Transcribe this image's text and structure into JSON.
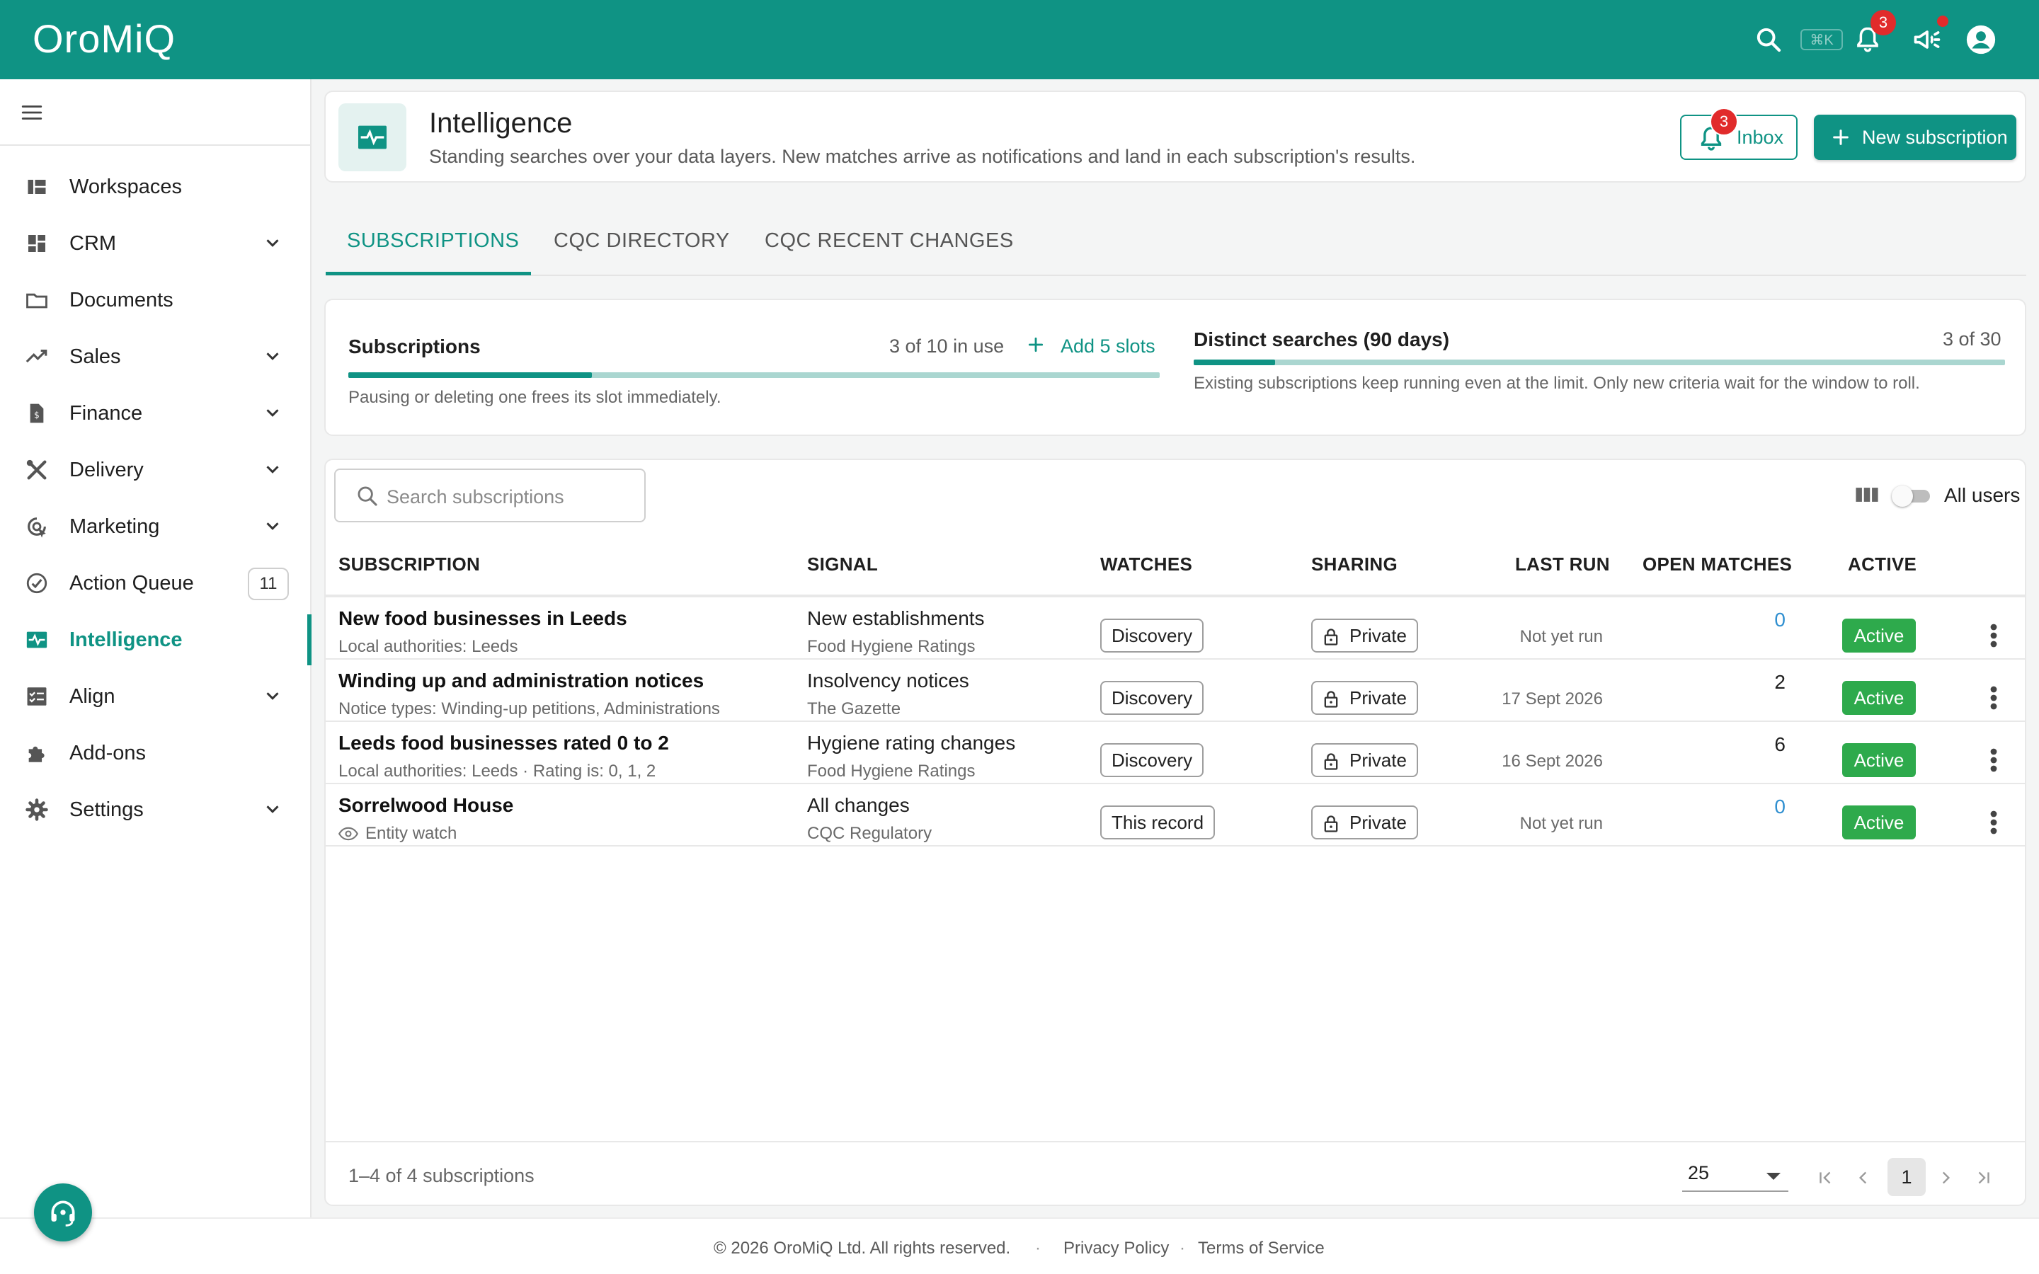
{
  "app": {
    "logo": "OroMiQ",
    "shortcut_hint": "⌘K",
    "notifications_count": "3"
  },
  "colors": {
    "brand": "#0f9384",
    "badge": "#e12b2b",
    "active_status": "#2eaa4c"
  },
  "sidebar": {
    "items": [
      {
        "label": "Workspaces",
        "icon": "workspaces-icon"
      },
      {
        "label": "CRM",
        "icon": "dashboard-grid-icon"
      },
      {
        "label": "Documents",
        "icon": "folder-icon"
      },
      {
        "label": "Sales",
        "icon": "trending-up-icon"
      },
      {
        "label": "Finance",
        "icon": "invoice-icon"
      },
      {
        "label": "Delivery",
        "icon": "tools-icon"
      },
      {
        "label": "Marketing",
        "icon": "target-icon"
      },
      {
        "label": "Action Queue",
        "icon": "check-circle-icon",
        "count": "11"
      },
      {
        "label": "Intelligence",
        "icon": "pulse-monitor-icon"
      },
      {
        "label": "Align",
        "icon": "checklist-icon"
      },
      {
        "label": "Add-ons",
        "icon": "puzzle-icon"
      },
      {
        "label": "Settings",
        "icon": "gear-icon"
      }
    ]
  },
  "header": {
    "title": "Intelligence",
    "subtitle": "Standing searches over your data layers. New matches arrive as notifications and land in each subscription's results.",
    "inbox_label": "Inbox",
    "inbox_count": "3",
    "new_subscription_label": "New subscription"
  },
  "tabs": [
    {
      "label": "SUBSCRIPTIONS"
    },
    {
      "label": "CQC DIRECTORY"
    },
    {
      "label": "CQC RECENT CHANGES"
    }
  ],
  "usage": {
    "subscriptions": {
      "title": "Subscriptions",
      "count": "3 of 10 in use",
      "add_label": "Add 5 slots",
      "note": "Pausing or deleting one frees its slot immediately.",
      "used_fraction": 0.3
    },
    "searches": {
      "title": "Distinct searches (90 days)",
      "count": "3 of 30",
      "note": "Existing subscriptions keep running even at the limit. Only new criteria wait for the window to roll.",
      "used_fraction": 0.1
    }
  },
  "table": {
    "search_placeholder": "Search subscriptions",
    "all_users_label": "All users",
    "columns": {
      "subscription": "SUBSCRIPTION",
      "signal": "SIGNAL",
      "watches": "WATCHES",
      "sharing": "SHARING",
      "last_run": "LAST RUN",
      "open_matches": "OPEN MATCHES",
      "active": "ACTIVE"
    },
    "rows": [
      {
        "title": "New food businesses in Leeds",
        "sub": "Local authorities: Leeds",
        "signal": "New establishments",
        "source": "Food Hygiene Ratings",
        "watches": "Discovery",
        "sharing": "Private",
        "last_run": "Not yet run",
        "matches": "0",
        "status": "Active"
      },
      {
        "title": "Winding up and administration notices",
        "sub": "Notice types: Winding-up petitions, Administrations",
        "signal": "Insolvency notices",
        "source": "The Gazette",
        "watches": "Discovery",
        "sharing": "Private",
        "last_run": "17 Sept 2026",
        "matches": "2",
        "status": "Active"
      },
      {
        "title": "Leeds food businesses rated 0 to 2",
        "sub": "Local authorities: Leeds · Rating is: 0, 1, 2",
        "signal": "Hygiene rating changes",
        "source": "Food Hygiene Ratings",
        "watches": "Discovery",
        "sharing": "Private",
        "last_run": "16 Sept 2026",
        "matches": "6",
        "status": "Active"
      },
      {
        "title": "Sorrelwood House",
        "sub": "Entity watch",
        "signal": "All changes",
        "source": "CQC Regulatory",
        "watches": "This record",
        "sharing": "Private",
        "last_run": "Not yet run",
        "matches": "0",
        "status": "Active"
      }
    ],
    "range_text": "1–4 of 4 subscriptions",
    "per_page": "25",
    "current_page": "1"
  },
  "footer": {
    "copyright": "© 2026 OroMiQ Ltd. All rights reserved.",
    "privacy": "Privacy Policy",
    "terms": "Terms of Service"
  }
}
